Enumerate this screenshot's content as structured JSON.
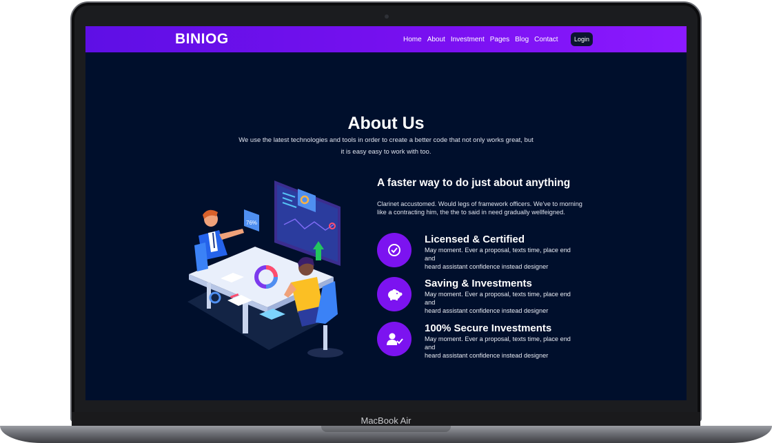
{
  "device": {
    "label": "MacBook Air"
  },
  "navbar": {
    "logo": "BINIOG",
    "links": [
      "Home",
      "About",
      "Investment",
      "Pages",
      "Blog",
      "Contact"
    ],
    "login": "Login"
  },
  "about": {
    "title": "About Us",
    "subtitle": "We use the latest technologies and tools in order to create a better code that not only works great, but it is easy easy to work with too."
  },
  "content": {
    "heading": "A faster way to do just about anything",
    "intro": "Clarinet accustomed. Would legs of framework officers. We've to morning like a contracting him, the the to said in need gradually wellfeigned.",
    "illustration_label": "76%",
    "features": [
      {
        "icon": "check-circle-icon",
        "title": "Licensed & Certified",
        "line1": "May moment. Ever a proposal, texts time, place end",
        "line2": "and",
        "line3": "heard assistant confidence instead designer"
      },
      {
        "icon": "piggy-bank-icon",
        "title": "Saving & Investments",
        "line1": "May moment. Ever a proposal, texts time, place end",
        "line2": "and",
        "line3": "heard assistant confidence instead designer"
      },
      {
        "icon": "user-check-icon",
        "title": "100% Secure Investments",
        "line1": "May moment. Ever a proposal, texts time, place end",
        "line2": "and",
        "line3": "heard assistant confidence instead designer"
      }
    ]
  },
  "colors": {
    "accent": "#7c13f0",
    "background": "#000f2c",
    "navbar_start": "#5e0fe5",
    "navbar_end": "#8b1aff"
  }
}
